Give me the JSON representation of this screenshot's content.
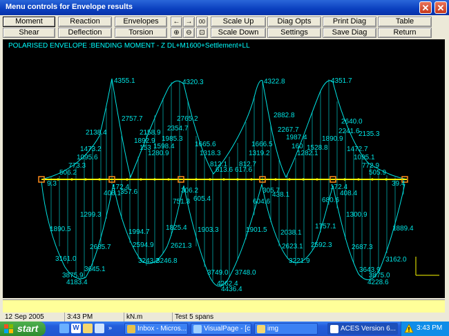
{
  "window": {
    "title": "Menu controls for Envelope results"
  },
  "toolbar": {
    "row1": [
      "Moment",
      "Reaction",
      "Envelopes",
      "Scale Up",
      "Diag Opts",
      "Print Diag",
      "Table"
    ],
    "row2": [
      "Shear",
      "Deflection",
      "Torsion",
      "Scale Down",
      "Settings",
      "Save Diag",
      "Return"
    ],
    "zoom_label": "00"
  },
  "diagram": {
    "title": "POLARISED ENVELOPE :BENDING MOMENT - Z   DL+M1600+Settlement+LL",
    "labels": [
      "4355.1",
      "4320.3",
      "4322.8",
      "4351.7",
      "2757.7",
      "2765.2",
      "2882.8",
      "2640.0",
      "2138.4",
      "2158.9",
      "2354.7",
      "2267.7",
      "2241.6",
      "2135.3",
      "1892.9",
      "1985.3",
      "1987.4",
      "1890.9",
      "1473.2",
      "153",
      "1598.4",
      "1665.6",
      "1666.5",
      "160",
      "1528.8",
      "1472.7",
      "1095.6",
      "1280.9",
      "1318.3",
      "1319.2",
      "1282.1",
      "1095.1",
      "773.3",
      "812.1",
      "812.7",
      "772.9",
      "506.2",
      "613.6",
      "617.6",
      "505.9",
      "9.3",
      "172.4",
      "306.2",
      "305.7",
      "172.4",
      "39.4",
      "408.1",
      "357.6",
      "751.3",
      "605.4",
      "604.6",
      "438.1",
      "680.6",
      "408.4",
      "1299.3",
      "1300.9",
      "1890.5",
      "1994.7",
      "1825.4",
      "1903.3",
      "1901.5",
      "2038.1",
      "1757.1",
      "1889.4",
      "2685.7",
      "2594.9",
      "2621.3",
      "2623.1",
      "2592.3",
      "2687.3",
      "3161.0",
      "3243.2",
      "3246.8",
      "3221.9",
      "3162.0",
      "3645.1",
      "3643.9",
      "3875.9",
      "3749.0",
      "3748.0",
      "3875.0",
      "4183.4",
      "4262.4",
      "4228.6",
      "4436.4"
    ]
  },
  "status": {
    "date": "12 Sep 2005",
    "time": "3:43 PM",
    "units": "kN.m",
    "info": "Test 5 spans"
  },
  "taskbar": {
    "start": "start",
    "tasks": [
      "Inbox - Micros...",
      "VisualPage - [c...",
      "img",
      "ACES Version 6..."
    ],
    "clock": "3:43 PM"
  },
  "colors": {
    "diagram_line": "#00e5e5",
    "beam": "#ffff00",
    "support": "#ff8c1a",
    "background": "#000000"
  }
}
